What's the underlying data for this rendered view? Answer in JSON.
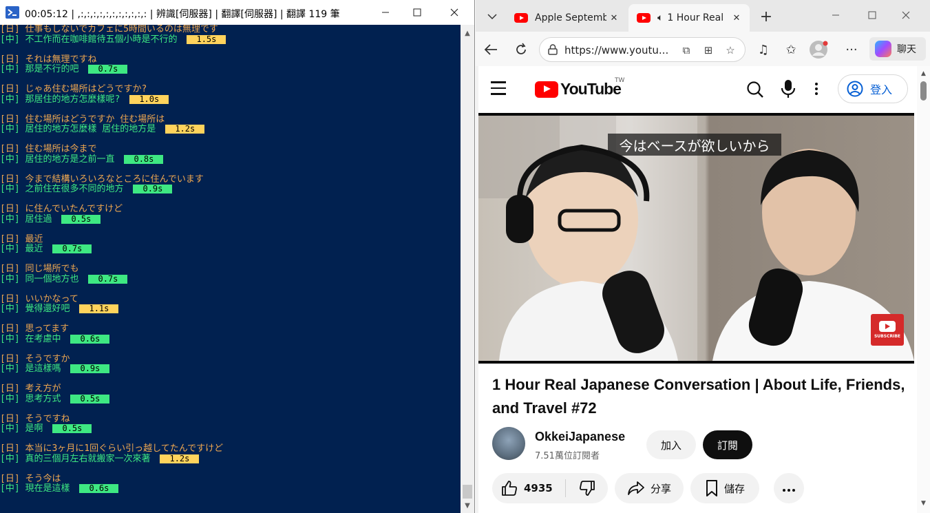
{
  "console": {
    "elapsed": "00:05:12",
    "title_rest": "| ,:,:,:,:,:,:,:,:,:,:,: | 辨識[伺服器] | 翻譯[伺服器] | 翻譯 119 筆",
    "entries": [
      {
        "ja": "[日] 仕事もしないでカフェに5時間いるのは無理です",
        "zh": "[中] 不工作而在咖啡館待五個小時是不行的",
        "time": "1.5s",
        "color": "yellow"
      },
      {
        "ja": "[日] それは無理ですね",
        "zh": "[中] 那是不行的吧",
        "time": "0.7s",
        "color": "green"
      },
      {
        "ja": "[日] じゃあ住む場所はどうですか?",
        "zh": "[中] 那居住的地方怎麼樣呢?",
        "time": "1.0s",
        "color": "yellow"
      },
      {
        "ja": "[日] 住む場所はどうですか 住む場所は",
        "zh": "[中] 居住的地方怎麼樣 居住的地方是",
        "time": "1.2s",
        "color": "yellow"
      },
      {
        "ja": "[日] 住む場所は今まで",
        "zh": "[中] 居住的地方是之前一直",
        "time": "0.8s",
        "color": "green"
      },
      {
        "ja": "[日] 今まで結構いろいろなところに住んでいます",
        "zh": "[中] 之前住在很多不同的地方",
        "time": "0.9s",
        "color": "green"
      },
      {
        "ja": "[日] に住んでいたんですけど",
        "zh": "[中] 居住過",
        "time": "0.5s",
        "color": "green"
      },
      {
        "ja": "[日] 最近",
        "zh": "[中] 最近",
        "time": "0.7s",
        "color": "green"
      },
      {
        "ja": "[日] 同じ場所でも",
        "zh": "[中] 同一個地方也",
        "time": "0.7s",
        "color": "green"
      },
      {
        "ja": "[日] いいかなって",
        "zh": "[中] 覺得還好吧",
        "time": "1.1s",
        "color": "yellow"
      },
      {
        "ja": "[日] 思ってます",
        "zh": "[中] 在考慮中",
        "time": "0.6s",
        "color": "green"
      },
      {
        "ja": "[日] そうですか",
        "zh": "[中] 是這樣嗎",
        "time": "0.9s",
        "color": "green"
      },
      {
        "ja": "[日] 考え方が",
        "zh": "[中] 思考方式",
        "time": "0.5s",
        "color": "green"
      },
      {
        "ja": "[日] そうですね",
        "zh": "[中] 是啊",
        "time": "0.5s",
        "color": "green"
      },
      {
        "ja": "[日] 本当に3ヶ月に1回ぐらい引っ越してたんですけど",
        "zh": "[中] 真的三個月左右就搬家一次來著",
        "time": "1.2s",
        "color": "yellow"
      },
      {
        "ja": "[日] そう今は",
        "zh": "[中] 現在是這樣",
        "time": "0.6s",
        "color": "green"
      }
    ]
  },
  "browser": {
    "tabs": [
      {
        "label": "Apple Septembe"
      },
      {
        "label": "1 Hour Real"
      }
    ],
    "url": "https://www.youtu...",
    "copilot_label": "聊天"
  },
  "youtube": {
    "logo_text": "YouTube",
    "region": "TW",
    "signin_label": "登入",
    "subtitle": "今はベースが欲しいから",
    "subscribe_overlay": "SUBSCRIBE",
    "title": "1 Hour Real Japanese Conversation | About Life, Friends, and Travel #72",
    "channel_name": "OkkeiJapanese",
    "channel_subs": "7.51萬位訂閱者",
    "join_label": "加入",
    "subscribe_label": "訂閱",
    "like_count": "4935",
    "share_label": "分享",
    "save_label": "儲存"
  },
  "colors": {
    "console_bg": "#012150",
    "ja_text": "#f0a850",
    "zh_text": "#3ee882",
    "badge_green": "#3ee882",
    "badge_yellow": "#ffd35c",
    "yt_red": "#ff0000"
  }
}
